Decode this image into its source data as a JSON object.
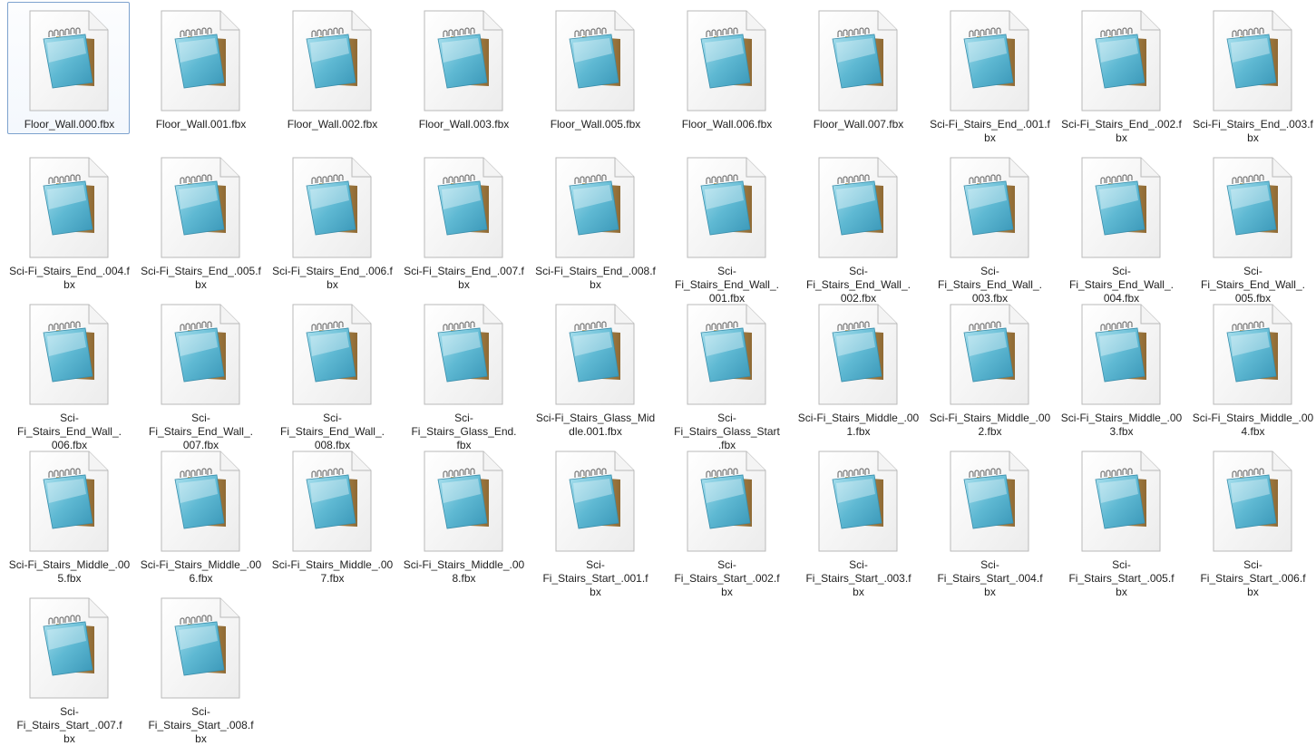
{
  "window": {
    "view": "large-icons",
    "selected_index": 0
  },
  "colors": {
    "selection_border": "#7da2ce",
    "icon_teal": "#5fb9d3"
  },
  "files": [
    {
      "name": "Floor_Wall.000.fbx",
      "icon": "notepad-file-icon"
    },
    {
      "name": "Floor_Wall.001.fbx",
      "icon": "notepad-file-icon"
    },
    {
      "name": "Floor_Wall.002.fbx",
      "icon": "notepad-file-icon"
    },
    {
      "name": "Floor_Wall.003.fbx",
      "icon": "notepad-file-icon"
    },
    {
      "name": "Floor_Wall.005.fbx",
      "icon": "notepad-file-icon"
    },
    {
      "name": "Floor_Wall.006.fbx",
      "icon": "notepad-file-icon"
    },
    {
      "name": "Floor_Wall.007.fbx",
      "icon": "notepad-file-icon"
    },
    {
      "name": "Sci-Fi_Stairs_End_.001.f\nbx",
      "icon": "notepad-file-icon"
    },
    {
      "name": "Sci-Fi_Stairs_End_.002.f\nbx",
      "icon": "notepad-file-icon"
    },
    {
      "name": "Sci-Fi_Stairs_End_.003.f\nbx",
      "icon": "notepad-file-icon"
    },
    {
      "name": "Sci-Fi_Stairs_End_.004.f\nbx",
      "icon": "notepad-file-icon"
    },
    {
      "name": "Sci-Fi_Stairs_End_.005.f\nbx",
      "icon": "notepad-file-icon"
    },
    {
      "name": "Sci-Fi_Stairs_End_.006.f\nbx",
      "icon": "notepad-file-icon"
    },
    {
      "name": "Sci-Fi_Stairs_End_.007.f\nbx",
      "icon": "notepad-file-icon"
    },
    {
      "name": "Sci-Fi_Stairs_End_.008.f\nbx",
      "icon": "notepad-file-icon"
    },
    {
      "name": "Sci-Fi_Stairs_End_Wall_.\n001.fbx",
      "icon": "notepad-file-icon"
    },
    {
      "name": "Sci-Fi_Stairs_End_Wall_.\n002.fbx",
      "icon": "notepad-file-icon"
    },
    {
      "name": "Sci-Fi_Stairs_End_Wall_.\n003.fbx",
      "icon": "notepad-file-icon"
    },
    {
      "name": "Sci-Fi_Stairs_End_Wall_.\n004.fbx",
      "icon": "notepad-file-icon"
    },
    {
      "name": "Sci-Fi_Stairs_End_Wall_.\n005.fbx",
      "icon": "notepad-file-icon"
    },
    {
      "name": "Sci-Fi_Stairs_End_Wall_.\n006.fbx",
      "icon": "notepad-file-icon"
    },
    {
      "name": "Sci-Fi_Stairs_End_Wall_.\n007.fbx",
      "icon": "notepad-file-icon"
    },
    {
      "name": "Sci-Fi_Stairs_End_Wall_.\n008.fbx",
      "icon": "notepad-file-icon"
    },
    {
      "name": "Sci-Fi_Stairs_Glass_End.\nfbx",
      "icon": "notepad-file-icon"
    },
    {
      "name": "Sci-Fi_Stairs_Glass_Mid\ndle.001.fbx",
      "icon": "notepad-file-icon"
    },
    {
      "name": "Sci-Fi_Stairs_Glass_Start\n.fbx",
      "icon": "notepad-file-icon"
    },
    {
      "name": "Sci-Fi_Stairs_Middle_.00\n1.fbx",
      "icon": "notepad-file-icon"
    },
    {
      "name": "Sci-Fi_Stairs_Middle_.00\n2.fbx",
      "icon": "notepad-file-icon"
    },
    {
      "name": "Sci-Fi_Stairs_Middle_.00\n3.fbx",
      "icon": "notepad-file-icon"
    },
    {
      "name": "Sci-Fi_Stairs_Middle_.00\n4.fbx",
      "icon": "notepad-file-icon"
    },
    {
      "name": "Sci-Fi_Stairs_Middle_.00\n5.fbx",
      "icon": "notepad-file-icon"
    },
    {
      "name": "Sci-Fi_Stairs_Middle_.00\n6.fbx",
      "icon": "notepad-file-icon"
    },
    {
      "name": "Sci-Fi_Stairs_Middle_.00\n7.fbx",
      "icon": "notepad-file-icon"
    },
    {
      "name": "Sci-Fi_Stairs_Middle_.00\n8.fbx",
      "icon": "notepad-file-icon"
    },
    {
      "name": "Sci-Fi_Stairs_Start_.001.f\nbx",
      "icon": "notepad-file-icon"
    },
    {
      "name": "Sci-Fi_Stairs_Start_.002.f\nbx",
      "icon": "notepad-file-icon"
    },
    {
      "name": "Sci-Fi_Stairs_Start_.003.f\nbx",
      "icon": "notepad-file-icon"
    },
    {
      "name": "Sci-Fi_Stairs_Start_.004.f\nbx",
      "icon": "notepad-file-icon"
    },
    {
      "name": "Sci-Fi_Stairs_Start_.005.f\nbx",
      "icon": "notepad-file-icon"
    },
    {
      "name": "Sci-Fi_Stairs_Start_.006.f\nbx",
      "icon": "notepad-file-icon"
    },
    {
      "name": "Sci-Fi_Stairs_Start_.007.f\nbx",
      "icon": "notepad-file-icon"
    },
    {
      "name": "Sci-Fi_Stairs_Start_.008.f\nbx",
      "icon": "notepad-file-icon"
    }
  ]
}
